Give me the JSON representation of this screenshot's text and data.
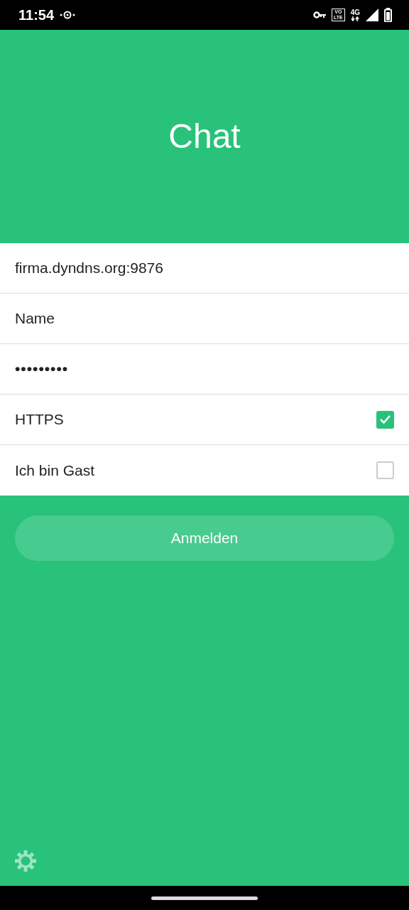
{
  "status_bar": {
    "time": "11:54",
    "volte_top": "VO",
    "volte_bottom": "LTE",
    "network": "4G"
  },
  "header": {
    "title": "Chat"
  },
  "fields": [
    {
      "kind": "text",
      "value": "firma.dyndns.org:9876"
    },
    {
      "kind": "text",
      "placeholder": "Name"
    },
    {
      "kind": "password",
      "value": "•••••••••"
    }
  ],
  "options": [
    {
      "label": "HTTPS",
      "checked": true
    },
    {
      "label": "Ich bin Gast",
      "checked": false
    }
  ],
  "login_button": {
    "label": "Anmelden",
    "disabled": true
  }
}
